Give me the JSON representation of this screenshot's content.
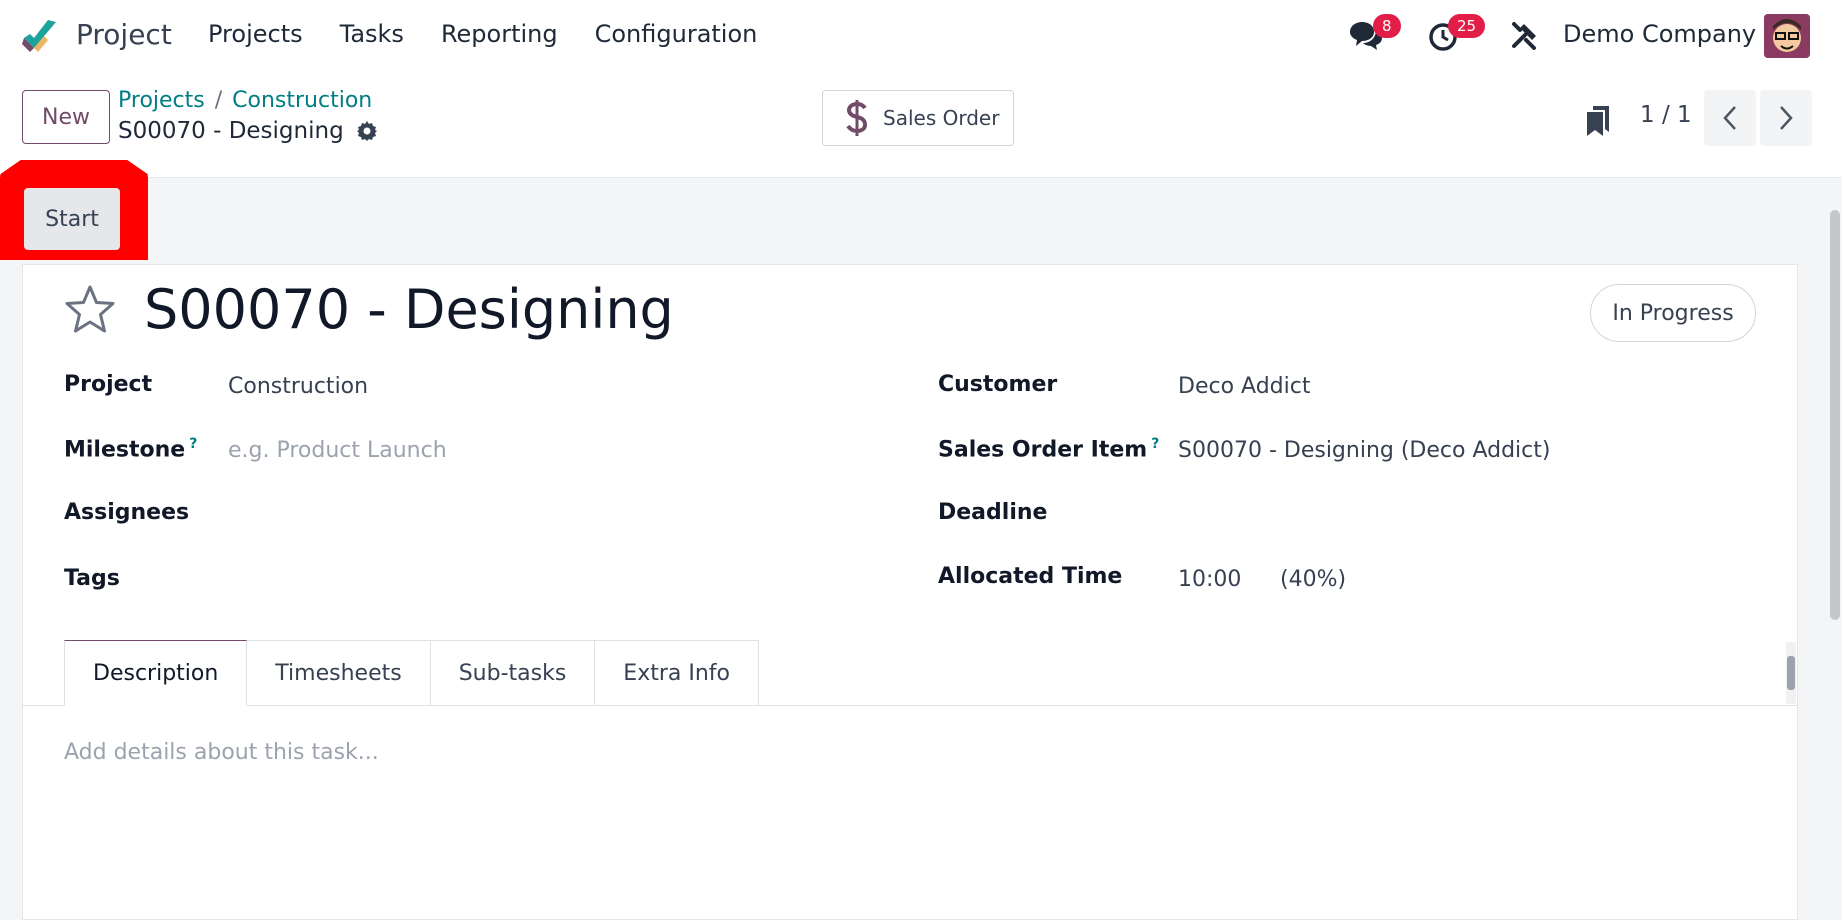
{
  "app": {
    "name": "Project",
    "menu": [
      "Projects",
      "Tasks",
      "Reporting",
      "Configuration"
    ],
    "messages_count": "8",
    "activities_count": "25",
    "company": "Demo Company"
  },
  "control": {
    "new_label": "New",
    "breadcrumb": [
      "Projects",
      "Construction"
    ],
    "breadcrumb_sep": "/",
    "record_name": "S00070 - Designing",
    "smart_button": "Sales Order",
    "pager": "1 / 1"
  },
  "statusbar": {
    "start_label": "Start"
  },
  "form": {
    "title": "S00070 - Designing",
    "stage": "In Progress",
    "left": {
      "project_label": "Project",
      "project_value": "Construction",
      "milestone_label": "Milestone",
      "milestone_placeholder": "e.g. Product Launch",
      "assignees_label": "Assignees",
      "tags_label": "Tags"
    },
    "right": {
      "customer_label": "Customer",
      "customer_value": "Deco Addict",
      "sale_line_label": "Sales Order Item",
      "sale_line_value": "S00070 - Designing (Deco Addict)",
      "deadline_label": "Deadline",
      "allocated_label": "Allocated Time",
      "allocated_value": "10:00",
      "allocated_percent": "(40%)"
    },
    "help_mark": "?",
    "tabs": [
      "Description",
      "Timesheets",
      "Sub-tasks",
      "Extra Info"
    ],
    "description_placeholder": "Add details about this task..."
  },
  "colors": {
    "brand": "#714b67",
    "link": "#017e84",
    "badge": "#e11d48",
    "highlight": "#ff0000"
  }
}
